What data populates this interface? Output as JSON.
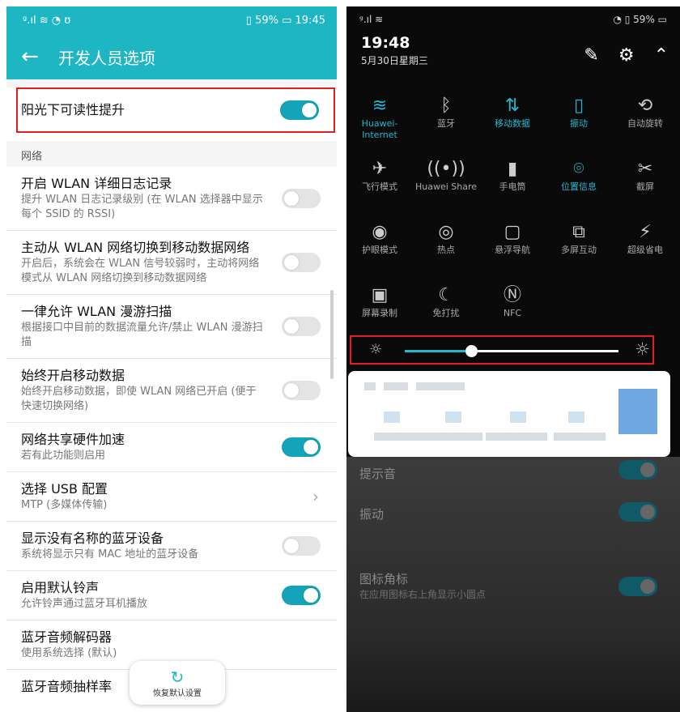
{
  "left": {
    "status": {
      "left": "ᵍ.ıl ≋ ◔ ʊ",
      "battery": "59%",
      "time": "19:45"
    },
    "appbar": {
      "title": "开发人员选项"
    },
    "highlighted_row": {
      "title": "阳光下可读性提升",
      "toggle_on": true
    },
    "section_network": "网络",
    "rows": [
      {
        "title": "开启 WLAN 详细日志记录",
        "subtitle": "提升 WLAN 日志记录级别 (在 WLAN 选择器中显示每个 SSID 的 RSSI)",
        "toggle_on": false
      },
      {
        "title": "主动从 WLAN 网络切换到移动数据网络",
        "subtitle": "开启后，系统会在 WLAN 信号较弱时，主动将网络模式从 WLAN 网络切换到移动数据网络",
        "toggle_on": false
      },
      {
        "title": "一律允许 WLAN 漫游扫描",
        "subtitle": "根据接口中目前的数据流量允许/禁止 WLAN 漫游扫描",
        "toggle_on": false
      },
      {
        "title": "始终开启移动数据",
        "subtitle": "始终开启移动数据，即使 WLAN 网络已开启 (便于快速切换网络)",
        "toggle_on": false
      },
      {
        "title": "网络共享硬件加速",
        "subtitle": "若有此功能则启用",
        "toggle_on": true
      },
      {
        "title": "选择 USB 配置",
        "subtitle": "MTP (多媒体传输)",
        "chevron": "›"
      },
      {
        "title": "显示没有名称的蓝牙设备",
        "subtitle": "系统将显示只有 MAC 地址的蓝牙设备",
        "toggle_on": false
      },
      {
        "title": "启用默认铃声",
        "subtitle": "允许铃声通过蓝牙耳机播放",
        "toggle_on": true
      },
      {
        "title": "蓝牙音频解码器",
        "subtitle": "使用系统选择 (默认)"
      },
      {
        "title": "蓝牙音频抽样率",
        "subtitle": ""
      }
    ],
    "restore_button": {
      "icon": "↻",
      "label": "恢复默认设置"
    }
  },
  "right": {
    "status": {
      "left": "ᵍ.ıl ≋",
      "battery": "59%"
    },
    "time": "19:48",
    "date": "5月30日星期三",
    "header_icons": {
      "edit": "✎",
      "settings": "⚙",
      "collapse": "⌃"
    },
    "tiles": [
      [
        {
          "label": "Huawei-\nInternet",
          "glyph": "≋",
          "active": true
        },
        {
          "label": "蓝牙",
          "glyph": "ᛒ",
          "active": false
        },
        {
          "label": "移动数据",
          "glyph": "⇅",
          "active": true
        },
        {
          "label": "振动",
          "glyph": "▯",
          "active": true
        },
        {
          "label": "自动旋转",
          "glyph": "⟲",
          "active": false
        }
      ],
      [
        {
          "label": "飞行模式",
          "glyph": "✈",
          "active": false
        },
        {
          "label": "Huawei Share",
          "glyph": "((•))",
          "active": false
        },
        {
          "label": "手电筒",
          "glyph": "▮",
          "active": false
        },
        {
          "label": "位置信息",
          "glyph": "⌾",
          "active": true
        },
        {
          "label": "截屏",
          "glyph": "✂",
          "active": false
        }
      ],
      [
        {
          "label": "护眼模式",
          "glyph": "◉",
          "active": false
        },
        {
          "label": "热点",
          "glyph": "◎",
          "active": false
        },
        {
          "label": "悬浮导航",
          "glyph": "▢",
          "active": false
        },
        {
          "label": "多屏互动",
          "glyph": "⧉",
          "active": false
        },
        {
          "label": "超级省电",
          "glyph": "⚡",
          "active": false
        }
      ],
      [
        {
          "label": "屏幕录制",
          "glyph": "▣",
          "active": false
        },
        {
          "label": "免打扰",
          "glyph": "☾",
          "active": false
        },
        {
          "label": "NFC",
          "glyph": "Ⓝ",
          "active": false
        }
      ]
    ],
    "brightness": {
      "min_icon": "☼",
      "max_icon": "☼",
      "level": 0.31
    },
    "dim_rows": [
      {
        "title": "提示音",
        "subtitle": ""
      },
      {
        "title": "振动",
        "subtitle": ""
      },
      {
        "title": "图标角标",
        "subtitle": "在应用图标右上角显示小圆点"
      }
    ]
  }
}
